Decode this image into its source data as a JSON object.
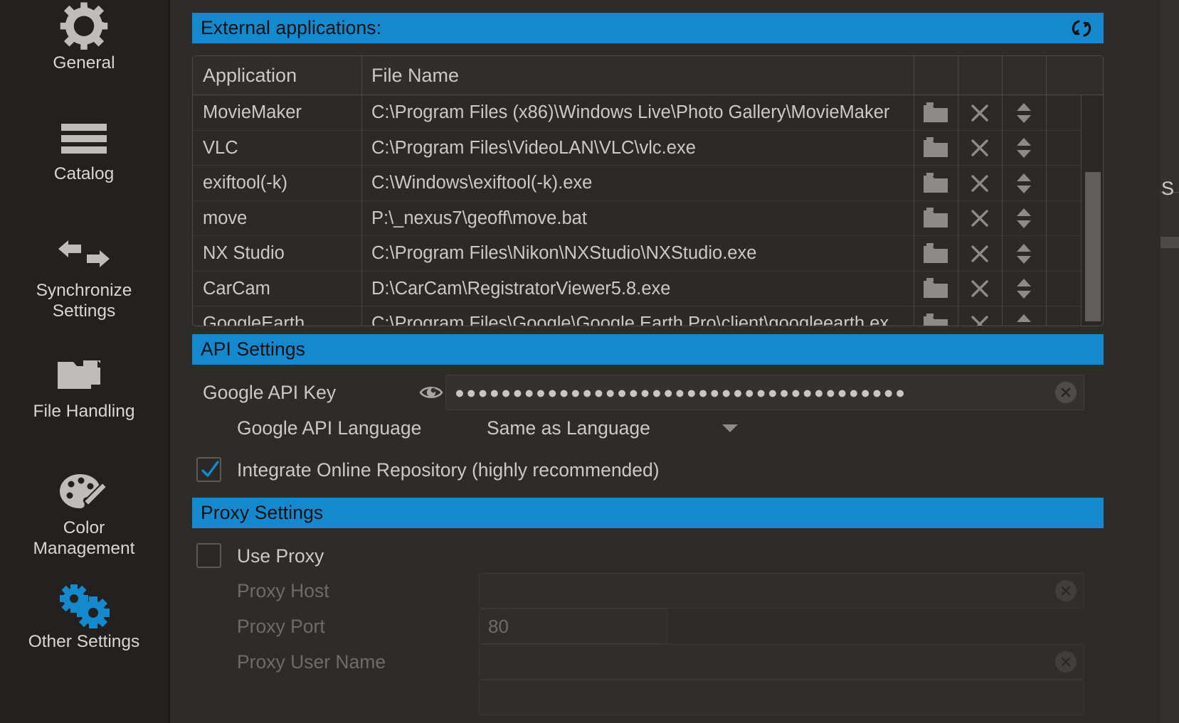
{
  "sidebar": {
    "items": [
      {
        "label": "General",
        "icon": "gear-icon"
      },
      {
        "label": "Catalog",
        "icon": "stacked-bars-icon"
      },
      {
        "label": "Synchronize\nSettings",
        "icon": "sync-arrows-icon"
      },
      {
        "label": "File Handling",
        "icon": "folders-icon"
      },
      {
        "label": "Color\nManagement",
        "icon": "palette-icon"
      },
      {
        "label": "Other Settings",
        "icon": "blue-gears-icon"
      }
    ]
  },
  "sections": {
    "external_applications": {
      "title": "External applications:",
      "reset_icon": "reset-circular-arrows-icon"
    },
    "api_settings": {
      "title": "API Settings"
    },
    "proxy_settings": {
      "title": "Proxy Settings"
    }
  },
  "apps_table": {
    "columns": [
      "Application",
      "File Name"
    ],
    "row_icons": [
      "folder-browse-icon",
      "delete-x-icon",
      "reorder-updown-icon"
    ],
    "rows": [
      {
        "application": "MovieMaker",
        "file_name": "C:\\Program Files (x86)\\Windows Live\\Photo Gallery\\MovieMaker"
      },
      {
        "application": "VLC",
        "file_name": "C:\\Program Files\\VideoLAN\\VLC\\vlc.exe"
      },
      {
        "application": "exiftool(-k)",
        "file_name": "C:\\Windows\\exiftool(-k).exe"
      },
      {
        "application": "move",
        "file_name": "P:\\_nexus7\\geoff\\move.bat"
      },
      {
        "application": "NX Studio",
        "file_name": "C:\\Program Files\\Nikon\\NXStudio\\NXStudio.exe"
      },
      {
        "application": "CarCam",
        "file_name": "D:\\CarCam\\RegistratorViewer5.8.exe"
      },
      {
        "application": "GoogleEarth",
        "file_name": "C:\\Program Files\\Google\\Google Earth Pro\\client\\googleearth.ex"
      }
    ]
  },
  "api": {
    "key_label": "Google API Key",
    "key_value": "●●●●●●●●●●●●●●●●●●●●●●●●●●●●●●●●●●●●●●●",
    "key_eye_icon": "eye-icon",
    "key_clear_icon": "clear-x-icon",
    "language_label": "Google API Language",
    "language_value": "Same as Language",
    "integrate_label": "Integrate Online Repository (highly recommended)",
    "integrate_checked": true
  },
  "proxy": {
    "use_proxy_label": "Use Proxy",
    "use_proxy_checked": false,
    "host_label": "Proxy Host",
    "host_value": "",
    "port_label": "Proxy Port",
    "port_value": "80",
    "user_label": "Proxy User Name",
    "user_value": ""
  },
  "behind_window": {
    "fragment": "S"
  },
  "colors": {
    "accent_blue": "#1489ce",
    "panel_bg": "#2e2c2a",
    "sidebar_bg": "#232120",
    "text": "#cbc9c5"
  }
}
